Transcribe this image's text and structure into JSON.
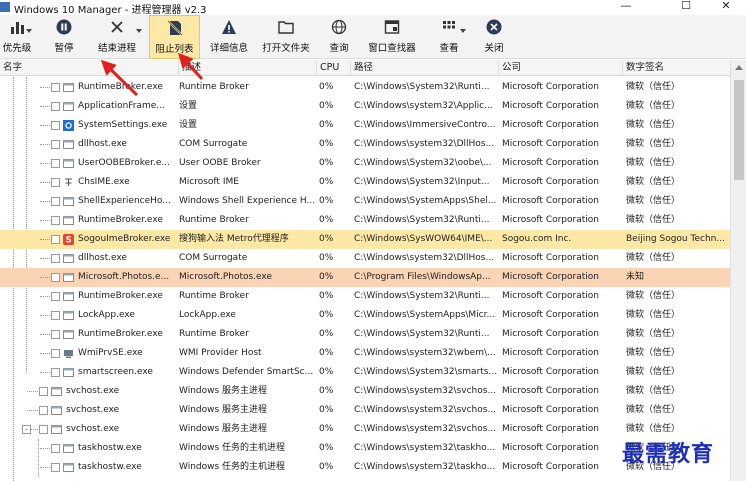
{
  "window": {
    "title": "Windows 10 Manager - 进程管理器 v2.3",
    "minimize": "—",
    "maximize": "☐",
    "close": "✕"
  },
  "toolbar": {
    "items": [
      {
        "label": "优先级",
        "icon": "bar-chart-icon",
        "dropdown": true
      },
      {
        "label": "暂停",
        "icon": "pause-icon",
        "dropdown": false
      },
      {
        "label": "结束进程",
        "icon": "close-x-icon",
        "dropdown": true
      },
      {
        "label": "阻止列表",
        "icon": "block-list-icon",
        "dropdown": false,
        "active": true
      },
      {
        "label": "详细信息",
        "icon": "warning-icon",
        "dropdown": false
      },
      {
        "label": "打开文件夹",
        "icon": "folder-icon",
        "dropdown": false
      },
      {
        "label": "查询",
        "icon": "globe-icon",
        "dropdown": false
      },
      {
        "label": "窗口查找器",
        "icon": "window-finder-icon",
        "dropdown": false
      },
      {
        "label": "查看",
        "icon": "grid-view-icon",
        "dropdown": true
      },
      {
        "label": "关闭",
        "icon": "close-circle-icon",
        "dropdown": false
      }
    ]
  },
  "columns": {
    "name": "名字",
    "desc": "描述",
    "cpu": "CPU",
    "path": "路径",
    "company": "公司",
    "signature": "数字签名"
  },
  "rows": [
    {
      "name": "RuntimeBroker.exe",
      "desc": "Runtime Broker",
      "cpu": "0%",
      "path": "C:\\Windows\\System32\\Runti...",
      "company": "Microsoft Corporation",
      "sig": "微软（信任）",
      "level": 2,
      "icon": "generic-exe-icon"
    },
    {
      "name": "ApplicationFrame...",
      "desc": "设置",
      "cpu": "0%",
      "path": "C:\\Windows\\system32\\Applic...",
      "company": "Microsoft Corporation",
      "sig": "微软（信任）",
      "level": 2,
      "icon": "generic-exe-icon"
    },
    {
      "name": "SystemSettings.exe",
      "desc": "设置",
      "cpu": "0%",
      "path": "C:\\Windows\\ImmersiveContro...",
      "company": "Microsoft Corporation",
      "sig": "微软（信任）",
      "level": 2,
      "icon": "settings-gear-icon"
    },
    {
      "name": "dllhost.exe",
      "desc": "COM Surrogate",
      "cpu": "0%",
      "path": "C:\\Windows\\system32\\DllHos...",
      "company": "Microsoft Corporation",
      "sig": "微软（信任）",
      "level": 2,
      "icon": "generic-exe-icon"
    },
    {
      "name": "UserOOBEBroker.e...",
      "desc": "User OOBE Broker",
      "cpu": "0%",
      "path": "C:\\Windows\\System32\\oobe\\...",
      "company": "Microsoft Corporation",
      "sig": "微软（信任）",
      "level": 2,
      "icon": "generic-exe-icon"
    },
    {
      "name": "ChsIME.exe",
      "desc": "Microsoft IME",
      "cpu": "0%",
      "path": "C:\\Windows\\System32\\Input...",
      "company": "Microsoft Corporation",
      "sig": "微软（信任）",
      "level": 2,
      "icon": "ime-icon"
    },
    {
      "name": "ShellExperienceHo...",
      "desc": "Windows Shell Experience H...",
      "cpu": "0%",
      "path": "C:\\Windows\\SystemApps\\Shel...",
      "company": "Microsoft Corporation",
      "sig": "微软（信任）",
      "level": 2,
      "icon": "generic-exe-icon"
    },
    {
      "name": "RuntimeBroker.exe",
      "desc": "Runtime Broker",
      "cpu": "0%",
      "path": "C:\\Windows\\System32\\Runti...",
      "company": "Microsoft Corporation",
      "sig": "微软（信任）",
      "level": 2,
      "icon": "generic-exe-icon"
    },
    {
      "name": "SogouImeBroker.exe",
      "desc": "搜狗输入法 Metro代理程序",
      "cpu": "0%",
      "path": "C:\\Windows\\SysWOW64\\IME\\...",
      "company": "Sogou.com Inc.",
      "sig": "Beijing Sogou Techn...",
      "level": 2,
      "icon": "sogou-icon",
      "highlight": "yellow"
    },
    {
      "name": "dllhost.exe",
      "desc": "COM Surrogate",
      "cpu": "0%",
      "path": "C:\\Windows\\system32\\DllHos...",
      "company": "Microsoft Corporation",
      "sig": "微软（信任）",
      "level": 2,
      "icon": "generic-exe-icon"
    },
    {
      "name": "Microsoft.Photos.e...",
      "desc": "Microsoft.Photos.exe",
      "cpu": "0%",
      "path": "C:\\Program  Files\\WindowsAp...",
      "company": "Microsoft Corporation",
      "sig": "未知",
      "level": 2,
      "icon": "generic-exe-icon",
      "highlight": "orange"
    },
    {
      "name": "RuntimeBroker.exe",
      "desc": "Runtime Broker",
      "cpu": "0%",
      "path": "C:\\Windows\\System32\\Runti...",
      "company": "Microsoft Corporation",
      "sig": "微软（信任）",
      "level": 2,
      "icon": "generic-exe-icon"
    },
    {
      "name": "LockApp.exe",
      "desc": "LockApp.exe",
      "cpu": "0%",
      "path": "C:\\Windows\\SystemApps\\Micr...",
      "company": "Microsoft Corporation",
      "sig": "微软（信任）",
      "level": 2,
      "icon": "generic-exe-icon"
    },
    {
      "name": "RuntimeBroker.exe",
      "desc": "Runtime Broker",
      "cpu": "0%",
      "path": "C:\\Windows\\System32\\Runti...",
      "company": "Microsoft Corporation",
      "sig": "微软（信任）",
      "level": 2,
      "icon": "generic-exe-icon"
    },
    {
      "name": "WmiPrvSE.exe",
      "desc": "WMI Provider Host",
      "cpu": "0%",
      "path": "C:\\Windows\\system32\\wbem\\...",
      "company": "Microsoft Corporation",
      "sig": "微软（信任）",
      "level": 2,
      "icon": "wmi-icon"
    },
    {
      "name": "smartscreen.exe",
      "desc": "Windows Defender SmartSc...",
      "cpu": "0%",
      "path": "C:\\Windows\\System32\\smarts...",
      "company": "Microsoft Corporation",
      "sig": "微软（信任）",
      "level": 2,
      "icon": "generic-exe-icon"
    },
    {
      "name": "svchost.exe",
      "desc": "Windows 服务主进程",
      "cpu": "0%",
      "path": "C:\\Windows\\system32\\svchos...",
      "company": "Microsoft Corporation",
      "sig": "微软（信任）",
      "level": 1,
      "icon": "generic-exe-icon"
    },
    {
      "name": "svchost.exe",
      "desc": "Windows 服务主进程",
      "cpu": "0%",
      "path": "C:\\Windows\\system32\\svchos...",
      "company": "Microsoft Corporation",
      "sig": "微软（信任）",
      "level": 1,
      "icon": "generic-exe-icon"
    },
    {
      "name": "svchost.exe",
      "desc": "Windows 服务主进程",
      "cpu": "0%",
      "path": "C:\\Windows\\system32\\svchos...",
      "company": "Microsoft Corporation",
      "sig": "微软（信任）",
      "level": 1,
      "icon": "generic-exe-icon",
      "expander": "-"
    },
    {
      "name": "taskhostw.exe",
      "desc": "Windows 任务的主机进程",
      "cpu": "0%",
      "path": "C:\\Windows\\system32\\taskho...",
      "company": "Microsoft Corporation",
      "sig": "微软（信任）",
      "level": 2,
      "icon": "generic-exe-icon"
    },
    {
      "name": "taskhostw.exe",
      "desc": "Windows 任务的主机进程",
      "cpu": "0%",
      "path": "C:\\Windows\\system32\\taskho...",
      "company": "Microsoft Corporation",
      "sig": "微软（信任）",
      "level": 2,
      "icon": "generic-exe-icon"
    }
  ],
  "watermark": "最需教育",
  "colors": {
    "accent_blue": "#1d2fb8",
    "highlight_yellow": "#fde9a5",
    "highlight_orange": "#fad4b4",
    "arrow_red": "#e0221d",
    "sogou_red": "#e8452c"
  }
}
